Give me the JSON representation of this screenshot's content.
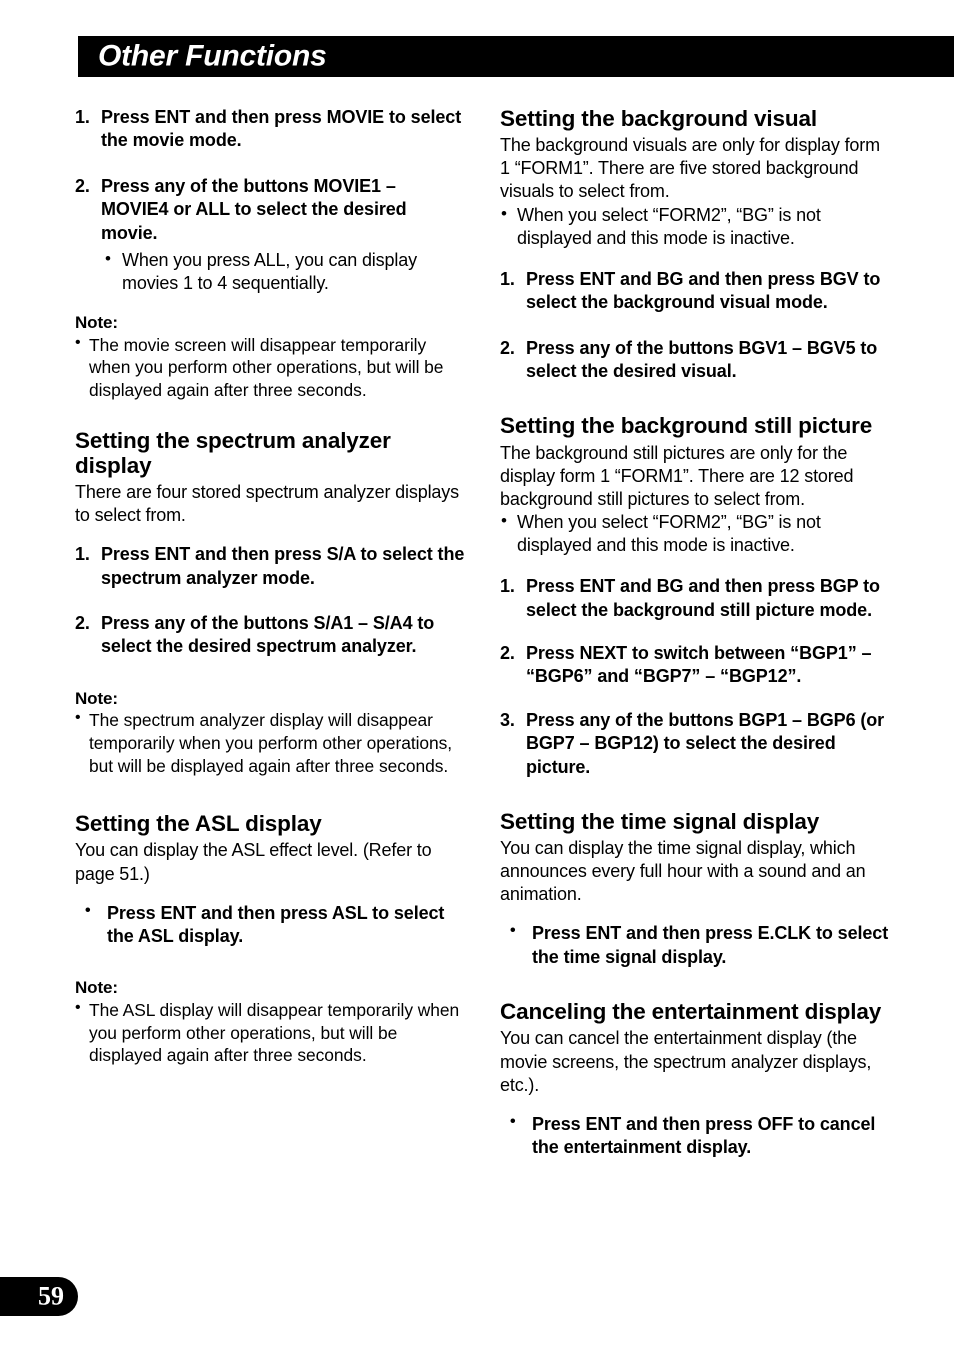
{
  "header": {
    "title": "Other Functions"
  },
  "page_number": "59",
  "left_column": {
    "step1": {
      "num": "1.",
      "text": "Press ENT and then press MOVIE to select the movie mode."
    },
    "step2": {
      "num": "2.",
      "text": "Press any of the buttons MOVIE1 – MOVIE4 or ALL to select the desired movie."
    },
    "step2_subbullet": {
      "dot": "•",
      "text": "When you press ALL, you can display movies 1 to 4 sequentially."
    },
    "note1": {
      "label": "Note:",
      "dot": "•",
      "text": "The movie screen will disappear temporarily when you perform other operations, but will be displayed again after three seconds."
    },
    "spectrum_section": {
      "title": "Setting the spectrum analyzer display",
      "intro": "There are four stored spectrum analyzer displays to select from.",
      "step1": {
        "num": "1.",
        "text": "Press ENT and then press S/A to select the spectrum analyzer mode."
      },
      "step2": {
        "num": "2.",
        "text": "Press any of the buttons S/A1 – S/A4 to select the desired spectrum analyzer."
      },
      "note": {
        "label": "Note:",
        "dot": "•",
        "text": "The spectrum analyzer display will disappear temporarily when you perform other operations, but will be displayed again after three seconds."
      }
    },
    "asl_section": {
      "title": "Setting the ASL display",
      "intro": "You can display the ASL effect level. (Refer to page 51.)",
      "bullet": {
        "dot": "•",
        "text": "Press ENT and then press ASL to select the ASL display."
      },
      "note": {
        "label": "Note:",
        "dot": "•",
        "text": "The ASL display will disappear temporarily when you perform other operations, but will be displayed again after three seconds."
      }
    }
  },
  "right_column": {
    "bg_visual_section": {
      "title": "Setting the background visual",
      "intro": "The background visuals are only for display form 1 “FORM1”. There are five stored background visuals to select from.",
      "bullet": {
        "dot": "•",
        "text": "When you select “FORM2”, “BG” is not displayed and this mode is inactive."
      },
      "step1": {
        "num": "1.",
        "text": "Press ENT and BG and then press BGV to select the background visual mode."
      },
      "step2": {
        "num": "2.",
        "text": "Press any of the buttons BGV1 – BGV5 to select the desired visual."
      }
    },
    "bg_still_section": {
      "title": "Setting the background still picture",
      "intro": "The background still pictures are only for the display form 1 “FORM1”. There are 12 stored background still pictures to select from.",
      "bullet": {
        "dot": "•",
        "text": "When you select “FORM2”, “BG” is not displayed and this mode is inactive."
      },
      "step1": {
        "num": "1.",
        "text": "Press ENT and BG and then press BGP to select the background still picture mode."
      },
      "step2": {
        "num": "2.",
        "text": "Press NEXT to switch between “BGP1” – “BGP6” and “BGP7” – “BGP12”."
      },
      "step3": {
        "num": "3.",
        "text": "Press any of the buttons BGP1 – BGP6 (or BGP7 – BGP12) to select the desired picture."
      }
    },
    "time_signal_section": {
      "title": "Setting the time signal display",
      "intro": "You can display the time signal display, which announces every full hour with a sound and an animation.",
      "bullet": {
        "dot": "•",
        "text": "Press ENT and then press E.CLK to select the time signal display."
      }
    },
    "cancel_section": {
      "title": "Canceling the entertainment display",
      "intro": "You can cancel the entertainment display (the movie screens, the spectrum analyzer displays, etc.).",
      "bullet": {
        "dot": "•",
        "text": "Press ENT and then press OFF to cancel the entertainment display."
      }
    }
  }
}
